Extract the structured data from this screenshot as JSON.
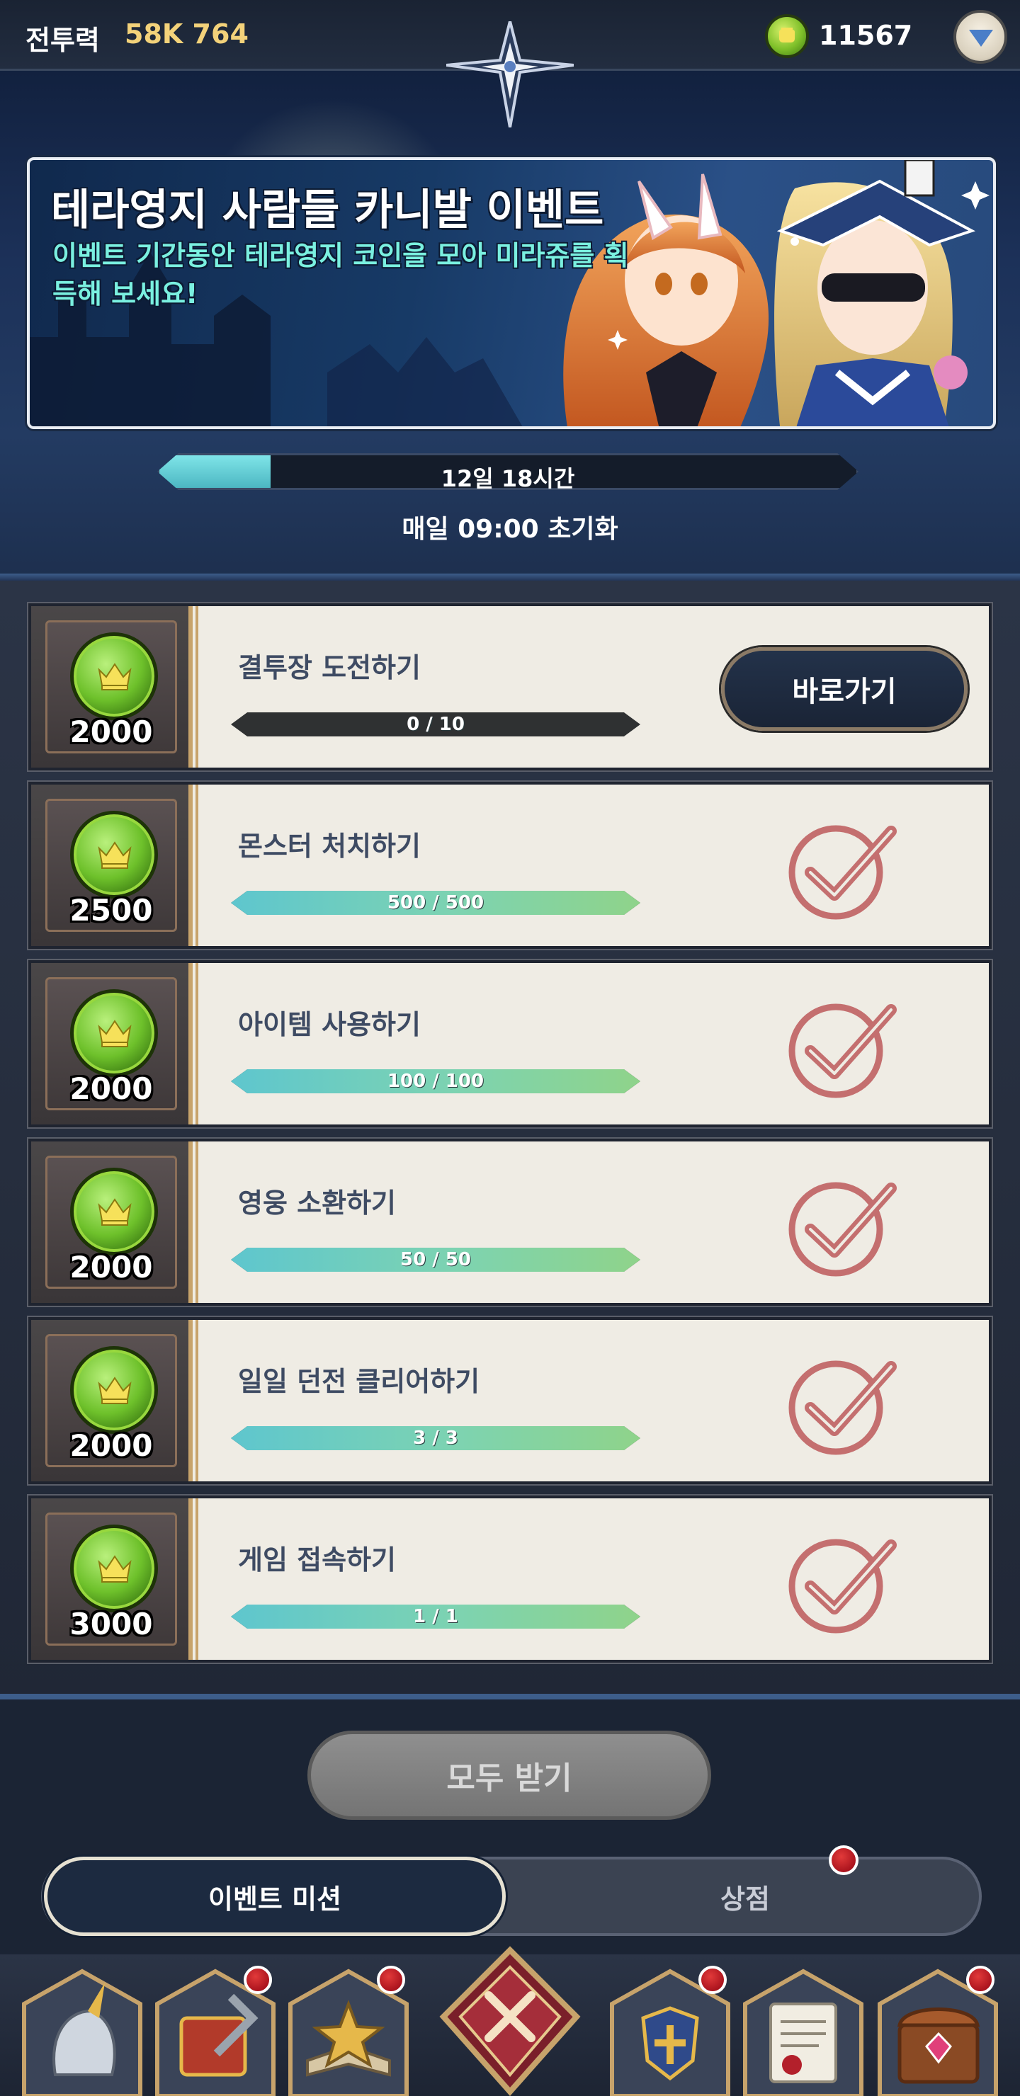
{
  "header": {
    "power_label": "전투력",
    "power_value": "58K 764",
    "coin_count": "11567"
  },
  "banner": {
    "title": "테라영지 사람들 카니발 이벤트",
    "subtitle": "이벤트 기간동안 테라영지 코인을 모아 미라쥬를 획득해 보세요!"
  },
  "timer": {
    "remaining": "12일 18시간",
    "progress": 0.16,
    "reset_note": "매일 09:00 초기화"
  },
  "missions": [
    {
      "reward": "2000",
      "title": "결투장 도전하기",
      "progress_text": "0 / 10",
      "progress": 0.0,
      "status": "go",
      "button_label": "바로가기"
    },
    {
      "reward": "2500",
      "title": "몬스터 처치하기",
      "progress_text": "500 / 500",
      "progress": 1.0,
      "status": "complete"
    },
    {
      "reward": "2000",
      "title": "아이템 사용하기",
      "progress_text": "100 / 100",
      "progress": 1.0,
      "status": "complete"
    },
    {
      "reward": "2000",
      "title": "영웅 소환하기",
      "progress_text": "50 / 50",
      "progress": 1.0,
      "status": "complete"
    },
    {
      "reward": "2000",
      "title": "일일 던전 클리어하기",
      "progress_text": "3 / 3",
      "progress": 1.0,
      "status": "complete"
    },
    {
      "reward": "3000",
      "title": "게임 접속하기",
      "progress_text": "1 / 1",
      "progress": 1.0,
      "status": "complete"
    }
  ],
  "claim_all_label": "모두 받기",
  "tabs": {
    "active": "이벤트 미션",
    "inactive": "상점"
  },
  "bottom_nav": [
    {
      "icon": "hero-helmet-icon",
      "badge": false
    },
    {
      "icon": "equipment-icon",
      "badge": true
    },
    {
      "icon": "spellbook-icon",
      "badge": true
    },
    {
      "icon": "close-battle-icon",
      "badge": false
    },
    {
      "icon": "guild-shield-icon",
      "badge": true
    },
    {
      "icon": "scroll-letter-icon",
      "badge": false
    },
    {
      "icon": "treasure-chest-icon",
      "badge": true
    }
  ],
  "colors": {
    "accent_teal": "#5ec6ce",
    "check_red": "#c46f6f",
    "coin_green": "#6ec12b",
    "badge_red": "#a40f1a"
  }
}
